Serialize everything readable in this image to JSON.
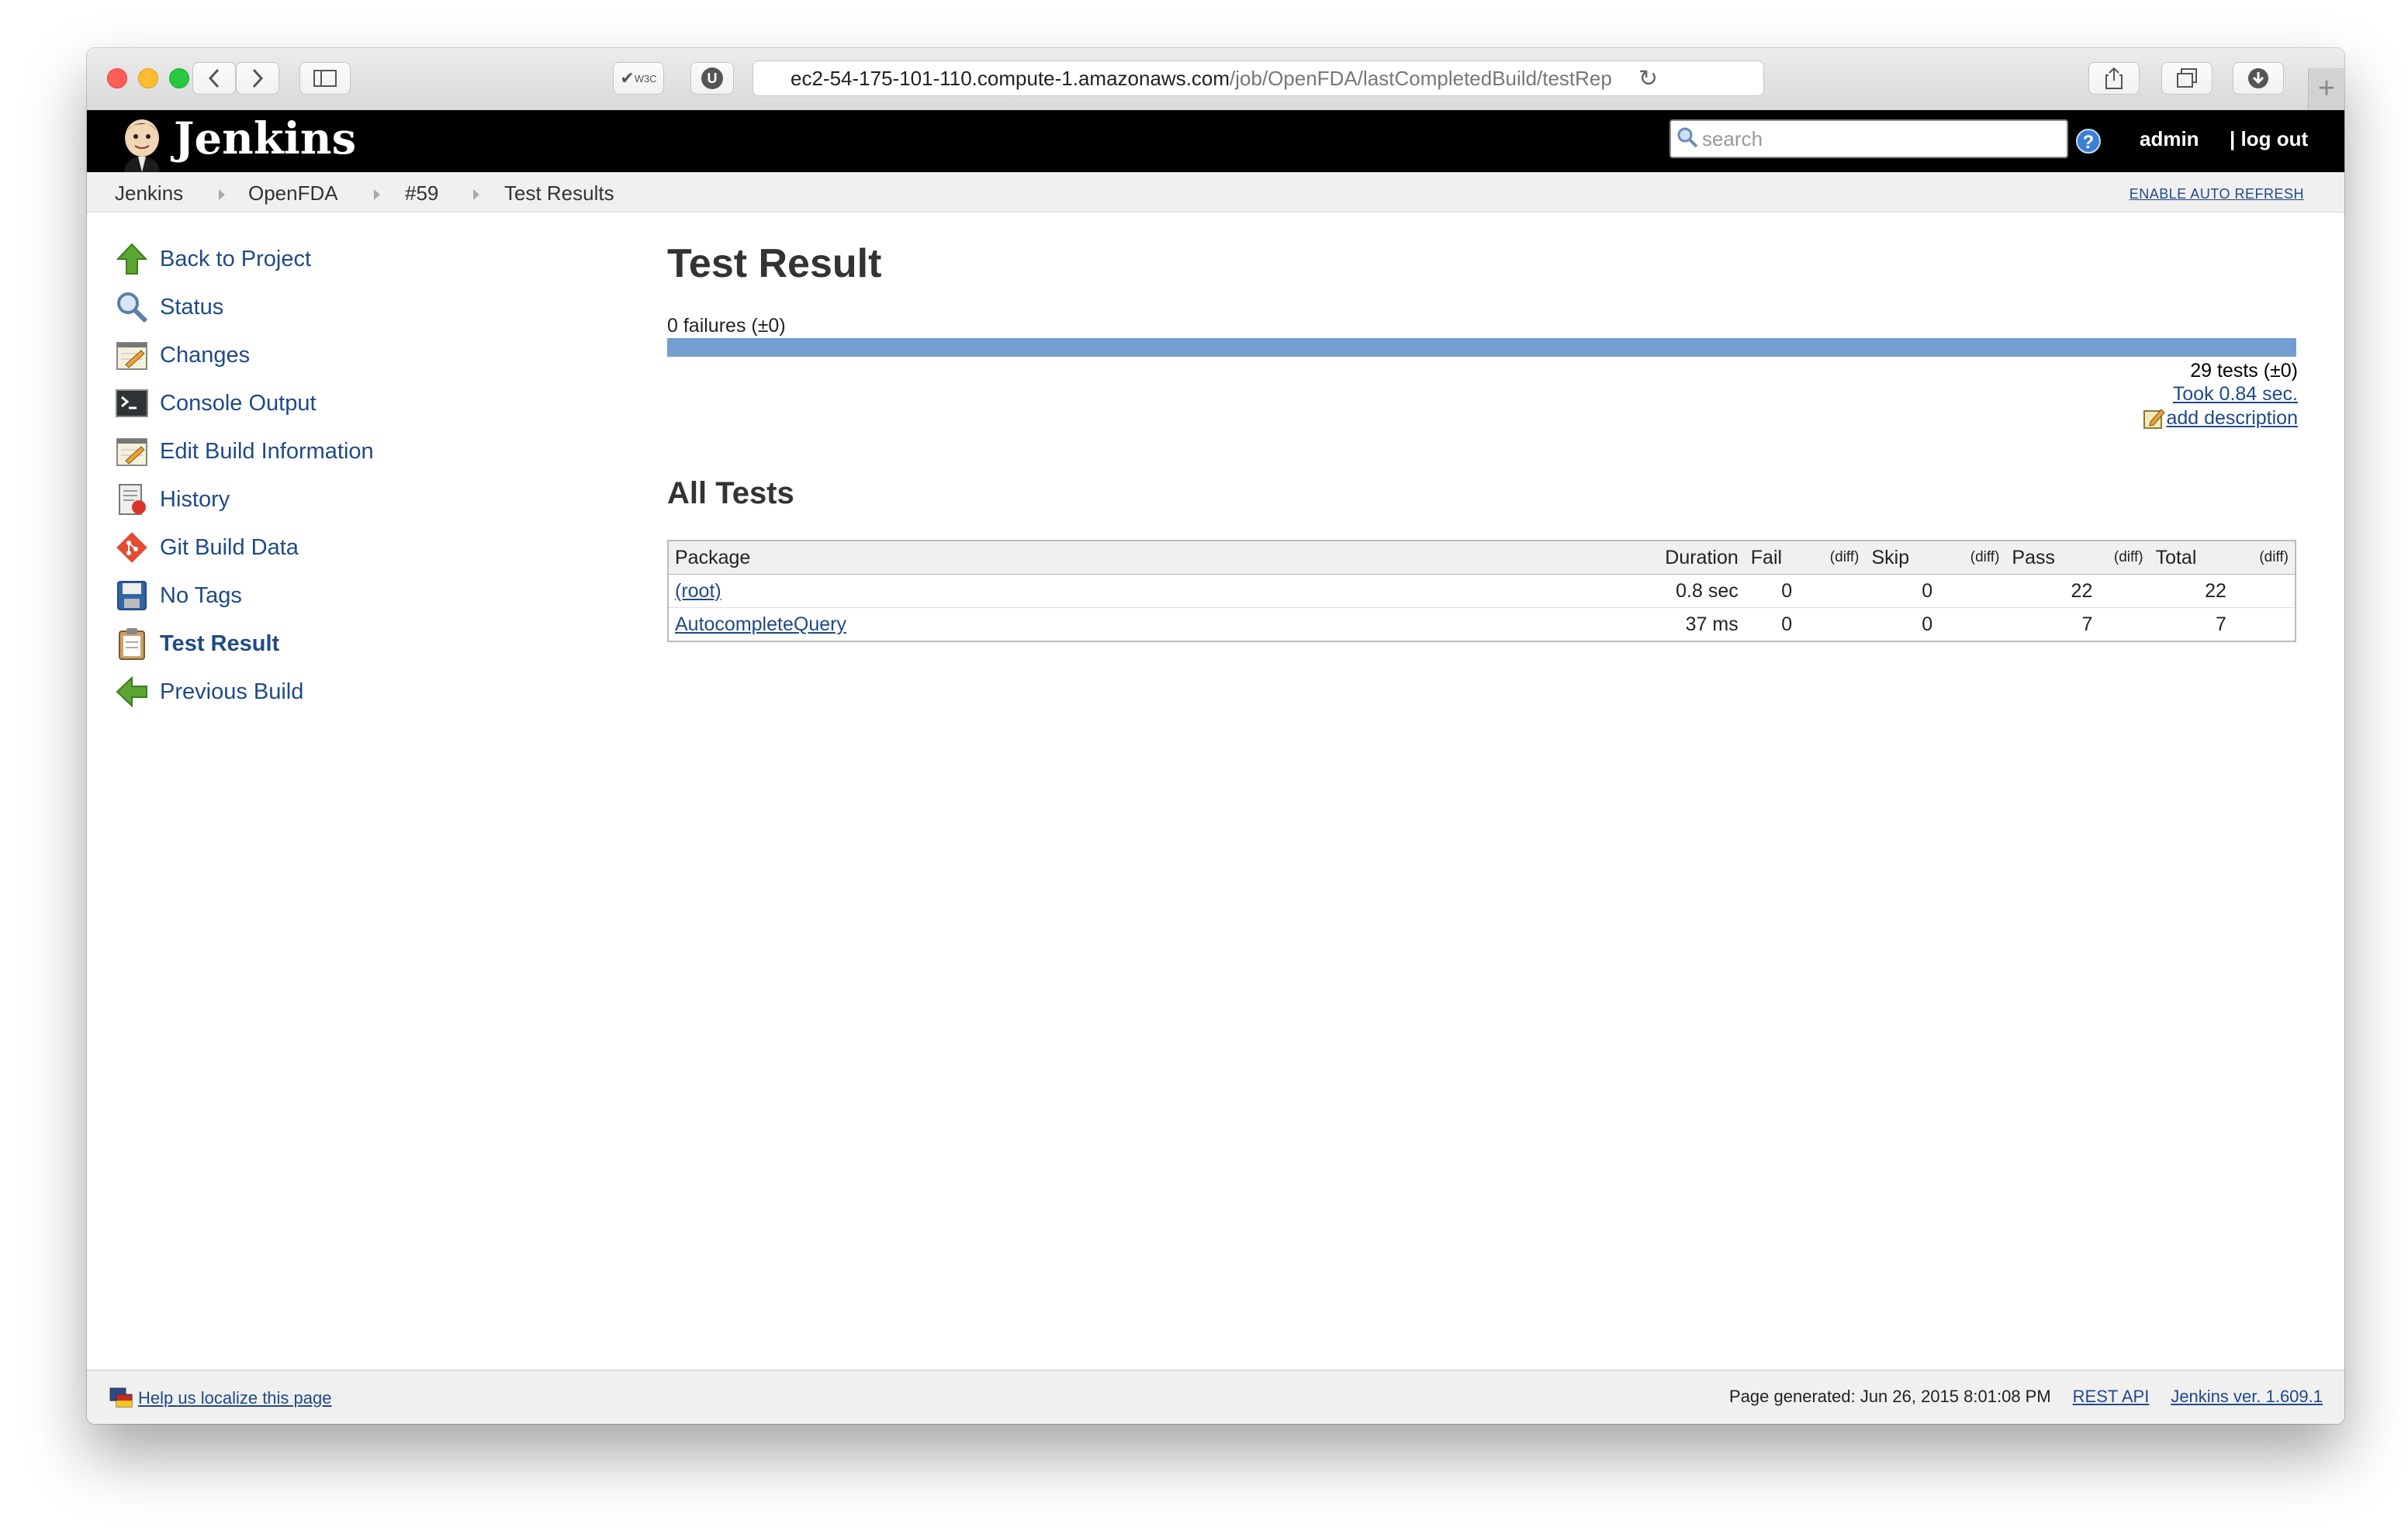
{
  "browser": {
    "url_host": "ec2-54-175-101-110.compute-1.amazonaws.com",
    "url_path": "/job/OpenFDA/lastCompletedBuild/testRep",
    "ext1_label": "W3C",
    "ext2_label": "U",
    "newtab_label": "+"
  },
  "header": {
    "brand": "Jenkins",
    "search_placeholder": "search",
    "help_label": "?",
    "user": "admin",
    "logout": "| log out"
  },
  "breadcrumbs": [
    "Jenkins",
    "OpenFDA",
    "#59",
    "Test Results"
  ],
  "auto_refresh": "ENABLE AUTO REFRESH",
  "sidebar": {
    "items": [
      {
        "label": "Back to Project",
        "icon": "up-arrow-icon"
      },
      {
        "label": "Status",
        "icon": "magnifier-icon"
      },
      {
        "label": "Changes",
        "icon": "notepad-icon"
      },
      {
        "label": "Console Output",
        "icon": "terminal-icon"
      },
      {
        "label": "Edit Build Information",
        "icon": "notepad-icon"
      },
      {
        "label": "History",
        "icon": "history-icon"
      },
      {
        "label": "Git Build Data",
        "icon": "git-icon"
      },
      {
        "label": "No Tags",
        "icon": "floppy-icon"
      },
      {
        "label": "Test Result",
        "icon": "clipboard-icon"
      },
      {
        "label": "Previous Build",
        "icon": "left-arrow-icon"
      }
    ]
  },
  "main": {
    "title": "Test Result",
    "failures": "0 failures (±0)",
    "tests": "29 tests (±0)",
    "took": "Took 0.84 sec.",
    "add_description": "add description",
    "all_tests": "All Tests"
  },
  "table": {
    "headers": {
      "package": "Package",
      "duration": "Duration",
      "fail": "Fail",
      "fail_diff": "(diff)",
      "skip": "Skip",
      "skip_diff": "(diff)",
      "pass": "Pass",
      "pass_diff": "(diff)",
      "total": "Total",
      "total_diff": "(diff)"
    },
    "rows": [
      {
        "package": "(root)",
        "duration": "0.8 sec",
        "fail": "0",
        "skip": "0",
        "pass": "22",
        "total": "22"
      },
      {
        "package": "AutocompleteQuery",
        "duration": "37 ms",
        "fail": "0",
        "skip": "0",
        "pass": "7",
        "total": "7"
      }
    ]
  },
  "footer": {
    "localize": "Help us localize this page",
    "generated": "Page generated: Jun 26, 2015 8:01:08 PM",
    "rest_api": "REST API",
    "version": "Jenkins ver. 1.609.1"
  },
  "colors": {
    "link": "#204a87",
    "progress_bar": "#729fcf",
    "header_bg": "#000000"
  }
}
